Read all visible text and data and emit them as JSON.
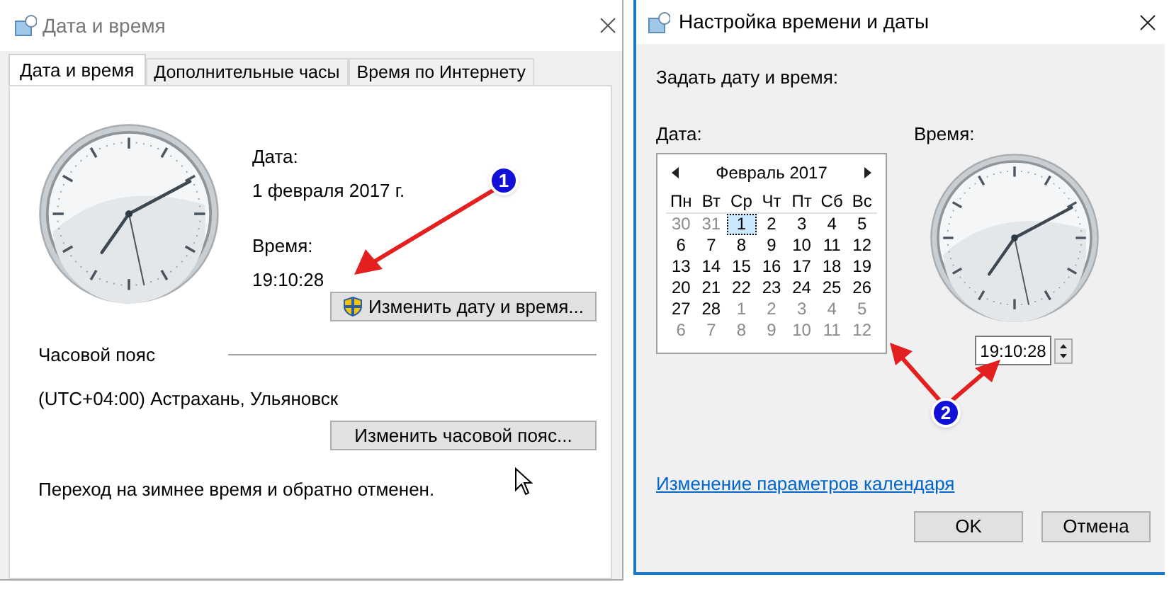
{
  "main_window": {
    "title": "Дата и время",
    "tabs": [
      {
        "label": "Дата и время",
        "selected": true
      },
      {
        "label": "Дополнительные часы",
        "selected": false
      },
      {
        "label": "Время по Интернету",
        "selected": false
      }
    ],
    "date_label": "Дата:",
    "date_value": "1 февраля 2017 г.",
    "time_label": "Время:",
    "time_value": "19:10:28",
    "change_datetime_button": "Изменить дату и время...",
    "timezone_heading": "Часовой пояс",
    "timezone_value": "(UTC+04:00) Астрахань, Ульяновск",
    "change_timezone_button": "Изменить часовой пояс...",
    "dst_note": "Переход на зимнее время и обратно отменен."
  },
  "settings_dialog": {
    "title": "Настройка времени и даты",
    "instruction": "Задать дату и время:",
    "date_label": "Дата:",
    "time_label": "Время:",
    "calendar": {
      "month": "Февраль 2017",
      "weekdays": [
        "Пн",
        "Вт",
        "Ср",
        "Чт",
        "Пт",
        "Сб",
        "Вс"
      ],
      "weeks": [
        [
          {
            "text": "30",
            "muted": true,
            "selected": false
          },
          {
            "text": "31",
            "muted": true,
            "selected": false
          },
          {
            "text": "1",
            "muted": false,
            "selected": true
          },
          {
            "text": "2",
            "muted": false,
            "selected": false
          },
          {
            "text": "3",
            "muted": false,
            "selected": false
          },
          {
            "text": "4",
            "muted": false,
            "selected": false
          },
          {
            "text": "5",
            "muted": false,
            "selected": false
          }
        ],
        [
          {
            "text": "6",
            "muted": false,
            "selected": false
          },
          {
            "text": "7",
            "muted": false,
            "selected": false
          },
          {
            "text": "8",
            "muted": false,
            "selected": false
          },
          {
            "text": "9",
            "muted": false,
            "selected": false
          },
          {
            "text": "10",
            "muted": false,
            "selected": false
          },
          {
            "text": "11",
            "muted": false,
            "selected": false
          },
          {
            "text": "12",
            "muted": false,
            "selected": false
          }
        ],
        [
          {
            "text": "13",
            "muted": false,
            "selected": false
          },
          {
            "text": "14",
            "muted": false,
            "selected": false
          },
          {
            "text": "15",
            "muted": false,
            "selected": false
          },
          {
            "text": "16",
            "muted": false,
            "selected": false
          },
          {
            "text": "17",
            "muted": false,
            "selected": false
          },
          {
            "text": "18",
            "muted": false,
            "selected": false
          },
          {
            "text": "19",
            "muted": false,
            "selected": false
          }
        ],
        [
          {
            "text": "20",
            "muted": false,
            "selected": false
          },
          {
            "text": "21",
            "muted": false,
            "selected": false
          },
          {
            "text": "22",
            "muted": false,
            "selected": false
          },
          {
            "text": "23",
            "muted": false,
            "selected": false
          },
          {
            "text": "24",
            "muted": false,
            "selected": false
          },
          {
            "text": "25",
            "muted": false,
            "selected": false
          },
          {
            "text": "26",
            "muted": false,
            "selected": false
          }
        ],
        [
          {
            "text": "27",
            "muted": false,
            "selected": false
          },
          {
            "text": "28",
            "muted": false,
            "selected": false
          },
          {
            "text": "1",
            "muted": true,
            "selected": false
          },
          {
            "text": "2",
            "muted": true,
            "selected": false
          },
          {
            "text": "3",
            "muted": true,
            "selected": false
          },
          {
            "text": "4",
            "muted": true,
            "selected": false
          },
          {
            "text": "5",
            "muted": true,
            "selected": false
          }
        ],
        [
          {
            "text": "6",
            "muted": true,
            "selected": false
          },
          {
            "text": "7",
            "muted": true,
            "selected": false
          },
          {
            "text": "8",
            "muted": true,
            "selected": false
          },
          {
            "text": "9",
            "muted": true,
            "selected": false
          },
          {
            "text": "10",
            "muted": true,
            "selected": false
          },
          {
            "text": "11",
            "muted": true,
            "selected": false
          },
          {
            "text": "12",
            "muted": true,
            "selected": false
          }
        ]
      ]
    },
    "time_field": "19:10:28",
    "calendar_settings_link": "Изменение параметров календаря",
    "buttons": [
      "OK",
      "Отмена"
    ]
  },
  "annotations": [
    {
      "label": "1"
    },
    {
      "label": "2"
    }
  ]
}
